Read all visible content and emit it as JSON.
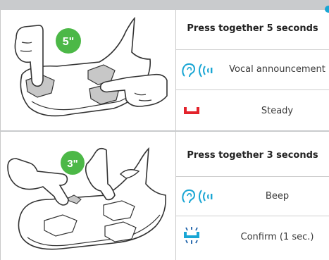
{
  "colors": {
    "badge": "#4cb847",
    "accent_blue": "#1aa6d4",
    "accent_red": "#e3232c",
    "divider": "#c9cbcd"
  },
  "sections": [
    {
      "badge": "5\"",
      "heading": "Press together 5 seconds",
      "rows": [
        {
          "icon": "ear-sound-icon",
          "label": "Vocal announcement"
        },
        {
          "icon": "red-led-steady-icon",
          "label": "Steady"
        }
      ]
    },
    {
      "badge": "3\"",
      "heading": "Press together 3 seconds",
      "rows": [
        {
          "icon": "ear-sound-icon",
          "label": "Beep"
        },
        {
          "icon": "blue-led-flash-icon",
          "label": "Confirm (1 sec.)"
        }
      ]
    }
  ]
}
